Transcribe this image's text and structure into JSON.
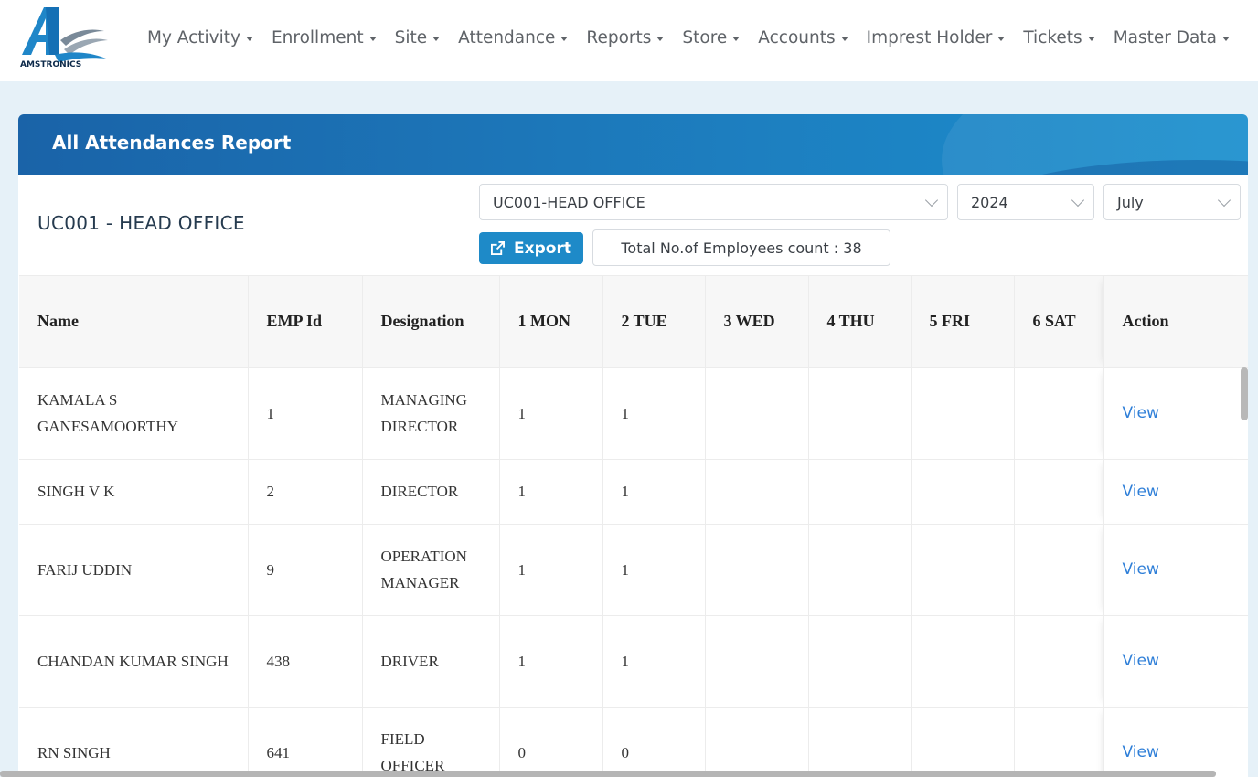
{
  "brand": {
    "logo_text": "AMSTRONICS"
  },
  "nav": {
    "items": [
      {
        "label": "My Activity"
      },
      {
        "label": "Enrollment"
      },
      {
        "label": "Site"
      },
      {
        "label": "Attendance"
      },
      {
        "label": "Reports"
      },
      {
        "label": "Store"
      },
      {
        "label": "Accounts"
      },
      {
        "label": "Imprest Holder"
      },
      {
        "label": "Tickets"
      },
      {
        "label": "Master Data"
      }
    ]
  },
  "card": {
    "title": "All Attendances Report",
    "office_title": "UC001 - HEAD OFFICE"
  },
  "filters": {
    "office": "UC001-HEAD OFFICE",
    "year": "2024",
    "month": "July"
  },
  "export_label": "Export",
  "employee_count_text": "Total No.of Employees count : 38",
  "table": {
    "headers": [
      "Name",
      "EMP Id",
      "Designation",
      "1 MON",
      "2 TUE",
      "3 WED",
      "4 THU",
      "5 FRI",
      "6 SAT",
      "Action"
    ],
    "rows": [
      {
        "name": "KAMALA S GANESAMOORTHY",
        "emp_id": "1",
        "designation": "MANAGING DIRECTOR",
        "d1": "1",
        "d2": "1",
        "d3": "",
        "d4": "",
        "d5": "",
        "d6": "",
        "action": "View"
      },
      {
        "name": "SINGH V K",
        "emp_id": "2",
        "designation": "DIRECTOR",
        "d1": "1",
        "d2": "1",
        "d3": "",
        "d4": "",
        "d5": "",
        "d6": "",
        "action": "View"
      },
      {
        "name": "FARIJ UDDIN",
        "emp_id": "9",
        "designation": "OPERATION MANAGER",
        "d1": "1",
        "d2": "1",
        "d3": "",
        "d4": "",
        "d5": "",
        "d6": "",
        "action": "View"
      },
      {
        "name": "CHANDAN KUMAR SINGH",
        "emp_id": "438",
        "designation": "DRIVER",
        "d1": "1",
        "d2": "1",
        "d3": "",
        "d4": "",
        "d5": "",
        "d6": "",
        "action": "View"
      },
      {
        "name": "RN SINGH",
        "emp_id": "641",
        "designation": "FIELD OFFICER",
        "d1": "0",
        "d2": "0",
        "d3": "",
        "d4": "",
        "d5": "",
        "d6": "",
        "action": "View"
      }
    ]
  },
  "colors": {
    "accent": "#1e8ac8",
    "header_start": "#1a63a8",
    "header_end": "#1a8fce",
    "link": "#2f7fd8",
    "page_bg": "#e6f1f8"
  }
}
